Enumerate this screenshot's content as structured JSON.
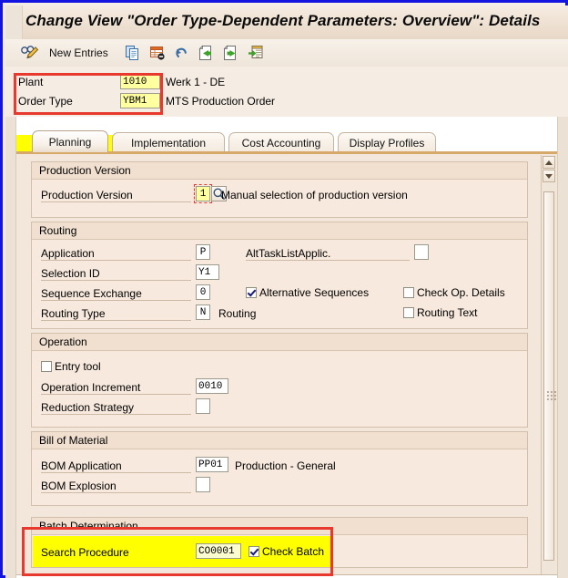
{
  "window": {
    "title": "Change View \"Order Type-Dependent Parameters: Overview\": Details"
  },
  "toolbar": {
    "new_entries_label": "New Entries",
    "icons": [
      {
        "name": "display-change-icon"
      },
      {
        "name": "copy-icon"
      },
      {
        "name": "delete-row-icon"
      },
      {
        "name": "undo-icon"
      },
      {
        "name": "previous-entry-icon"
      },
      {
        "name": "next-entry-icon"
      },
      {
        "name": "select-layout-icon"
      }
    ]
  },
  "header": {
    "plant": {
      "label": "Plant",
      "value": "1010",
      "description": "Werk 1 - DE"
    },
    "order_type": {
      "label": "Order Type",
      "value": "YBM1",
      "description": "MTS Production Order"
    }
  },
  "tabs": [
    {
      "label": "Planning",
      "active": true
    },
    {
      "label": "Implementation",
      "active": false
    },
    {
      "label": "Cost Accounting",
      "active": false
    },
    {
      "label": "Display Profiles",
      "active": false
    }
  ],
  "groups": {
    "production_version": {
      "title": "Production Version",
      "field_label": "Production Version",
      "value": "1",
      "description": "Manual selection of production version",
      "f4_icon": "magnifier-icon"
    },
    "routing": {
      "title": "Routing",
      "application": {
        "label": "Application",
        "value": "P"
      },
      "alt_task_list_applic": {
        "label": "AltTaskListApplic.",
        "value": ""
      },
      "selection_id": {
        "label": "Selection ID",
        "value": "Y1"
      },
      "sequence_exchange": {
        "label": "Sequence Exchange",
        "value": "0"
      },
      "alternative_sequences": {
        "label": "Alternative Sequences",
        "checked": true
      },
      "check_op_details": {
        "label": "Check Op. Details",
        "checked": false
      },
      "routing_type": {
        "label": "Routing Type",
        "value": "N",
        "description": "Routing"
      },
      "routing_text": {
        "label": "Routing Text",
        "checked": false
      }
    },
    "operation": {
      "title": "Operation",
      "entry_tool": {
        "label": "Entry tool",
        "checked": false
      },
      "operation_increment": {
        "label": "Operation Increment",
        "value": "0010"
      },
      "reduction_strategy": {
        "label": "Reduction Strategy",
        "value": ""
      }
    },
    "bill_of_material": {
      "title": "Bill of Material",
      "bom_application": {
        "label": "BOM Application",
        "value": "PP01",
        "description": "Production - General"
      },
      "bom_explosion": {
        "label": "BOM Explosion",
        "value": ""
      }
    },
    "batch_determination": {
      "title": "Batch Determination",
      "search_procedure": {
        "label": "Search Procedure",
        "value": "CO0001"
      },
      "check_batch": {
        "label": "Check Batch",
        "checked": true
      }
    }
  },
  "colors": {
    "window_border": "#1414e0",
    "highlight_box": "#e8392f",
    "field_highlight": "#ffff00",
    "input_yellow": "#ffffa0",
    "panel_bg": "#f3e7dc",
    "tab_underline": "#d6a96b"
  }
}
